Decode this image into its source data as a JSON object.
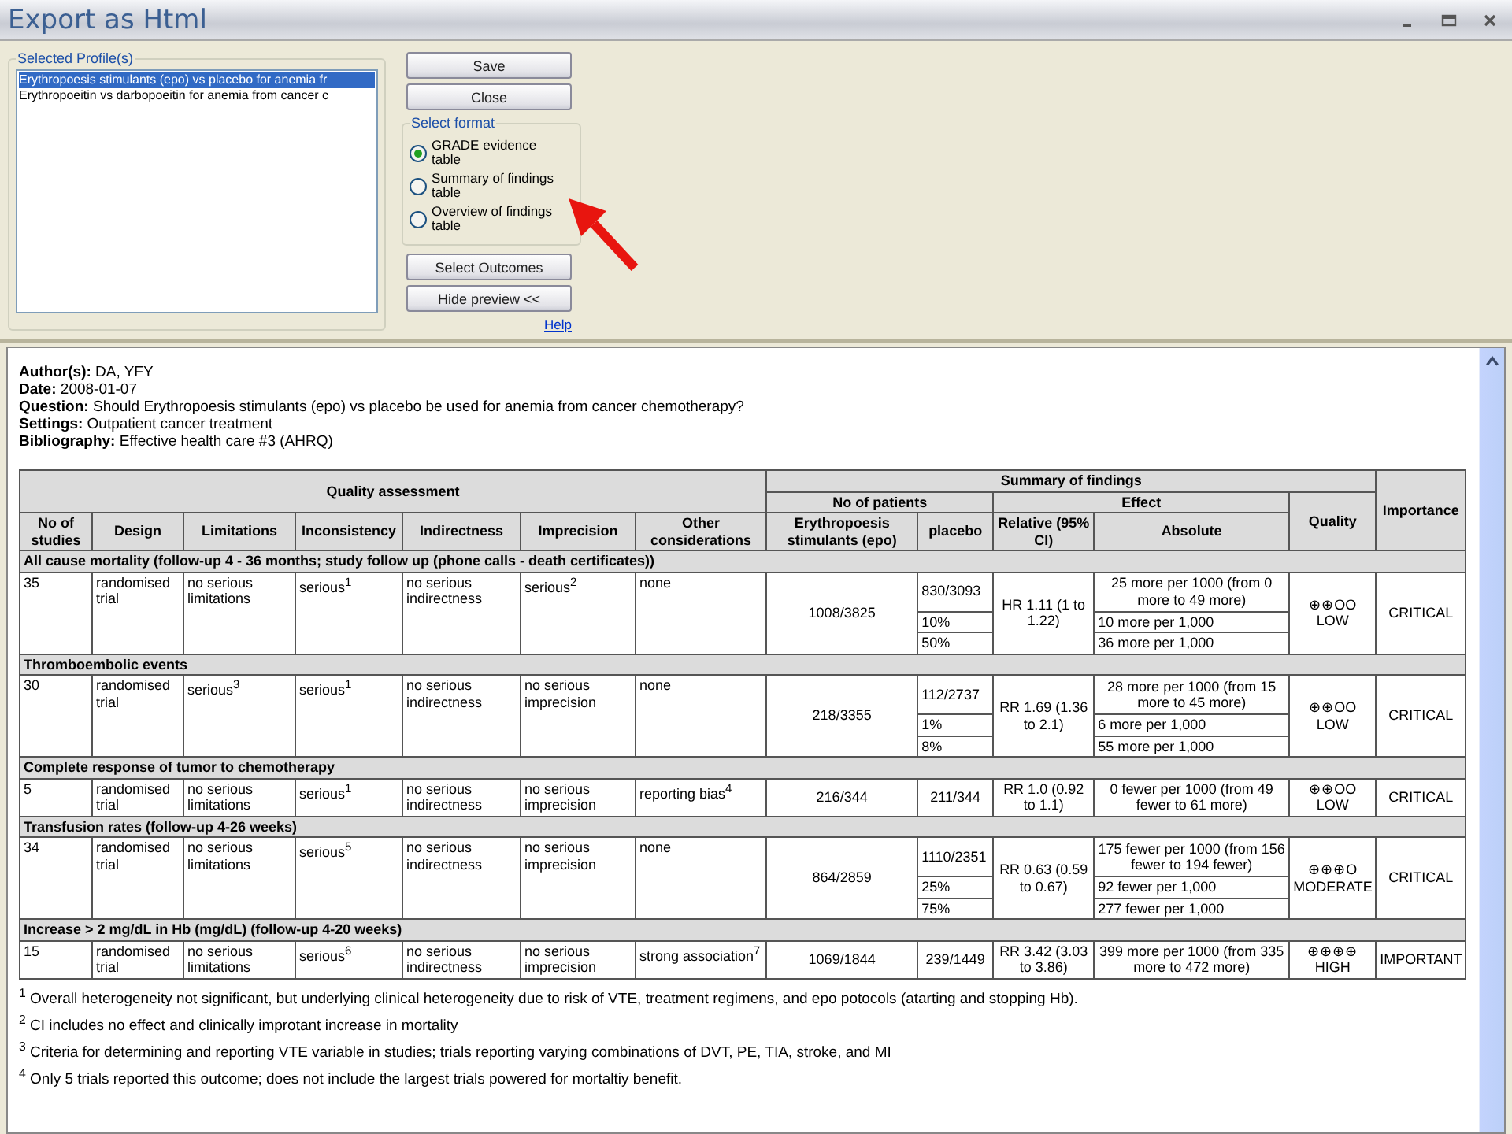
{
  "window": {
    "title": "Export as Html"
  },
  "profiles": {
    "label": "Selected Profile(s)",
    "items": [
      {
        "text": "Erythropoesis stimulants (epo) vs placebo for anemia fr",
        "selected": true
      },
      {
        "text": "Erythropoeitin vs darbopoeitin for anemia from cancer c",
        "selected": false
      }
    ]
  },
  "top_buttons": [
    "Save",
    "Close"
  ],
  "format": {
    "label": "Select format",
    "options": [
      {
        "text": "GRADE evidence table",
        "selected": true
      },
      {
        "text": "Summary of findings table",
        "selected": false
      },
      {
        "text": "Overview of findings table",
        "selected": false
      }
    ]
  },
  "bottom_buttons": [
    "Select Outcomes",
    "Hide preview <<"
  ],
  "help_link": "Help",
  "meta": [
    "**Author(s):** DA, YFY",
    "**Date:** 2008-01-07",
    "**Question:** Should Erythropoesis stimulants (epo) vs placebo be used for anemia from cancer chemotherapy?",
    "**Settings:** Outpatient cancer treatment",
    "**Bibliography:** Effective health care #3 (AHRQ)"
  ],
  "table": {
    "group_headers": {
      "quality_assessment": "Quality assessment",
      "summary": "Summary of findings",
      "importance": "Importance",
      "patients": "No of patients",
      "effect": "Effect",
      "quality": "Quality"
    },
    "columns": [
      "No of studies",
      "Design",
      "Limitations",
      "Inconsistency",
      "Indirectness",
      "Imprecision",
      "Other considerations",
      "Erythropoesis stimulants (epo)",
      "placebo",
      "Relative (95% CI)",
      "Absolute"
    ],
    "outcomes": [
      {
        "title": "All cause mortality (follow-up 4 - 36 months; study follow up (phone calls - death certificates))",
        "cells": [
          "35",
          "randomised trial",
          "no serious limitations",
          "serious$^{1}$",
          "no serious indirectness",
          "serious$^{2}$",
          "none"
        ],
        "epo": "1008/3825",
        "placebo": [
          "830/3093",
          "10%",
          "50%"
        ],
        "relative": "HR 1.11 (1 to 1.22)",
        "absolute": [
          "25 more per 1000 (from 0 more to 49 more)",
          "10 more per 1,000",
          "36 more per 1,000"
        ],
        "certainty": "⊕⊕OO",
        "quality": "LOW",
        "importance": "CRITICAL"
      },
      {
        "title": "Thromboembolic events",
        "cells": [
          "30",
          "randomised trial",
          "serious$^{3}$",
          "serious$^{1}$",
          "no serious indirectness",
          "no serious imprecision",
          "none"
        ],
        "epo": "218/3355",
        "placebo": [
          "112/2737",
          "1%",
          "8%"
        ],
        "relative": "RR 1.69 (1.36 to 2.1)",
        "absolute": [
          "28 more per 1000 (from 15 more to 45 more)",
          "6 more per 1,000",
          "55 more per 1,000"
        ],
        "certainty": "⊕⊕OO",
        "quality": "LOW",
        "importance": "CRITICAL"
      },
      {
        "title": "Complete response of tumor to chemotherapy",
        "cells": [
          "5",
          "randomised trial",
          "no serious limitations",
          "serious$^{1}$",
          "no serious indirectness",
          "no serious imprecision",
          "reporting bias$^{4}$"
        ],
        "epo": "216/344",
        "placebo": [
          "211/344"
        ],
        "relative": "RR 1.0 (0.92 to 1.1)",
        "absolute": [
          "0 fewer per 1000 (from 49 fewer to 61 more)"
        ],
        "certainty": "⊕⊕OO",
        "quality": "LOW",
        "importance": "CRITICAL"
      },
      {
        "title": "Transfusion rates (follow-up 4-26 weeks)",
        "cells": [
          "34",
          "randomised trial",
          "no serious limitations",
          "serious$^{5}$",
          "no serious indirectness",
          "no serious imprecision",
          "none"
        ],
        "epo": "864/2859",
        "placebo": [
          "1110/2351",
          "25%",
          "75%"
        ],
        "relative": "RR 0.63 (0.59 to 0.67)",
        "absolute": [
          "175 fewer per 1000 (from 156 fewer to 194 fewer)",
          "92 fewer per 1,000",
          "277 fewer per 1,000"
        ],
        "certainty": "⊕⊕⊕O",
        "quality": "MODERATE",
        "importance": "CRITICAL"
      },
      {
        "title": "Increase > 2 mg/dL in Hb (mg/dL) (follow-up 4-20 weeks)",
        "cells": [
          "15",
          "randomised trial",
          "no serious limitations",
          "serious$^{6}$",
          "no serious indirectness",
          "no serious imprecision",
          "strong association$^{7}$"
        ],
        "epo": "1069/1844",
        "placebo": [
          "239/1449"
        ],
        "relative": "RR 3.42 (3.03 to 3.86)",
        "absolute": [
          "399 more per 1000 (from 335 more to 472 more)"
        ],
        "certainty": "⊕⊕⊕⊕",
        "quality": "HIGH",
        "importance": "IMPORTANT"
      }
    ]
  },
  "footnotes": [
    "$^{1}$ Overall heterogeneity not significant, but underlying clinical heterogeneity due to risk of VTE, treatment regimens, and epo potocols (atarting and stopping Hb).",
    "$^{2}$ CI includes no effect and clinically improtant increase in mortality",
    "$^{3}$ Criteria for determining and reporting VTE variable in studies; trials reporting varying combinations of DVT, PE, TIA, stroke, and MI",
    "$^{4}$ Only 5 trials reported this outcome; does not include the largest trials powered for mortaltiy benefit."
  ]
}
